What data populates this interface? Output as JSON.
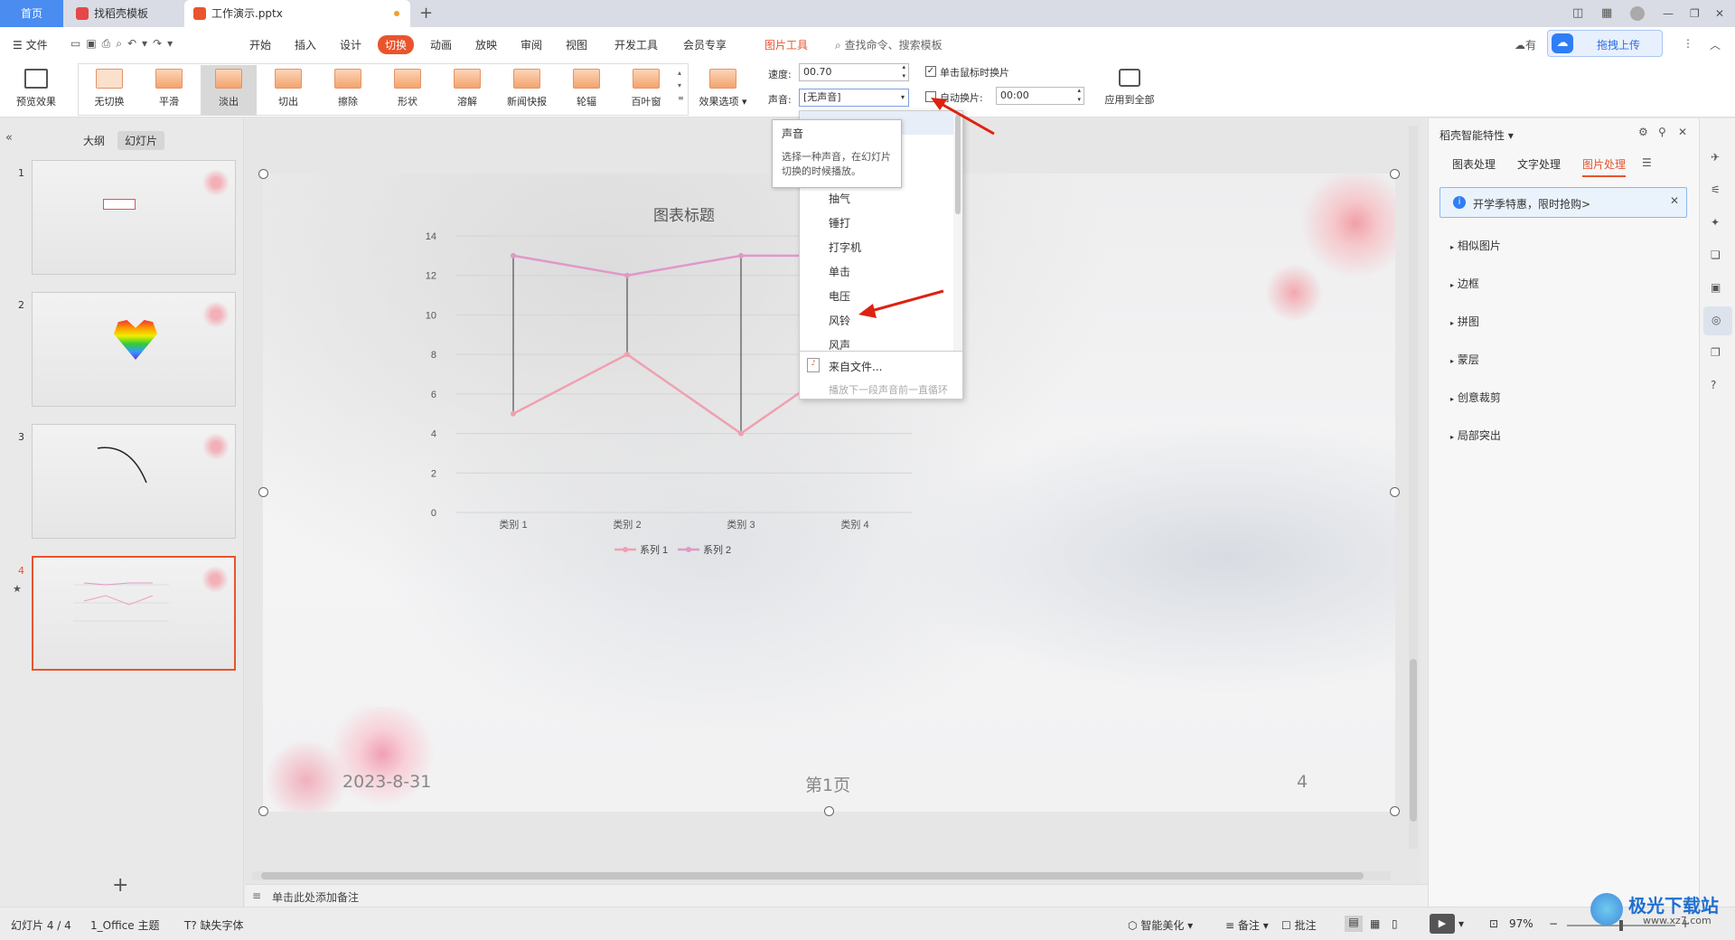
{
  "tabs": {
    "home": "首页",
    "template": "找稻壳模板",
    "doc": "工作演示.pptx",
    "add": "+"
  },
  "menu": {
    "file": "文件",
    "items": [
      "开始",
      "插入",
      "设计",
      "切换",
      "动画",
      "放映",
      "审阅",
      "视图",
      "开发工具",
      "会员专享"
    ],
    "picture_tools": "图片工具",
    "search": "查找命令、搜索模板",
    "upload": "拖拽上传",
    "has_prefix": "有"
  },
  "ribbon": {
    "preview": "预览效果",
    "effects": [
      "无切换",
      "平滑",
      "淡出",
      "切出",
      "擦除",
      "形状",
      "溶解",
      "新闻快报",
      "轮辐",
      "百叶窗"
    ],
    "effect_options": "效果选项",
    "speed_label": "速度:",
    "speed_value": "00.70",
    "sound_label": "声音:",
    "sound_value": "[无声音]",
    "click_switch": "单击鼠标时换片",
    "auto_switch": "自动换片:",
    "auto_value": "00:00",
    "apply_all": "应用到全部"
  },
  "tooltip": {
    "title": "声音",
    "body": "选择一种声音，在幻灯片切换的时候播放。"
  },
  "dropdown": {
    "items": [
      "抽气",
      "锤打",
      "打字机",
      "单击",
      "电压",
      "风铃",
      "风声"
    ],
    "from_file": "来自文件...",
    "loop": "播放下一段声音前一直循环"
  },
  "left": {
    "outline": "大纲",
    "slides": "幻灯片",
    "nums": [
      "1",
      "2",
      "3",
      "4"
    ],
    "add": "+"
  },
  "slide": {
    "date": "2023-8-31",
    "page": "第1页",
    "number": "4"
  },
  "chart_data": {
    "type": "line",
    "title": "图表标题",
    "categories": [
      "类别 1",
      "类别 2",
      "类别 3",
      "类别 4"
    ],
    "series": [
      {
        "name": "系列 1",
        "values": [
          5,
          8,
          4,
          8
        ],
        "color": "#f0a0b0"
      },
      {
        "name": "系列 2",
        "values": [
          13,
          12,
          13,
          13
        ],
        "color": "#e098c8"
      }
    ],
    "ylim": [
      0,
      14
    ],
    "yticks": [
      0,
      2,
      4,
      6,
      8,
      10,
      12,
      14
    ],
    "grid": true,
    "legend": "bottom",
    "high_low_lines": true
  },
  "right": {
    "title": "稻壳智能特性",
    "tabs": [
      "图表处理",
      "文字处理",
      "图片处理"
    ],
    "banner": "开学季特惠，限时抢购>",
    "items": [
      "相似图片",
      "边框",
      "拼图",
      "蒙层",
      "创意裁剪",
      "局部突出"
    ]
  },
  "notes": "单击此处添加备注",
  "status": {
    "slide": "幻灯片 4 / 4",
    "theme": "1_Office 主题",
    "font": "缺失字体",
    "beautify": "智能美化",
    "remarks": "备注",
    "comments": "批注",
    "zoom": "97%"
  },
  "watermark": {
    "name": "极光下载站",
    "url": "www.xz7.com"
  },
  "colors": {
    "accent": "#e9542c",
    "blue": "#4a8cf0"
  }
}
